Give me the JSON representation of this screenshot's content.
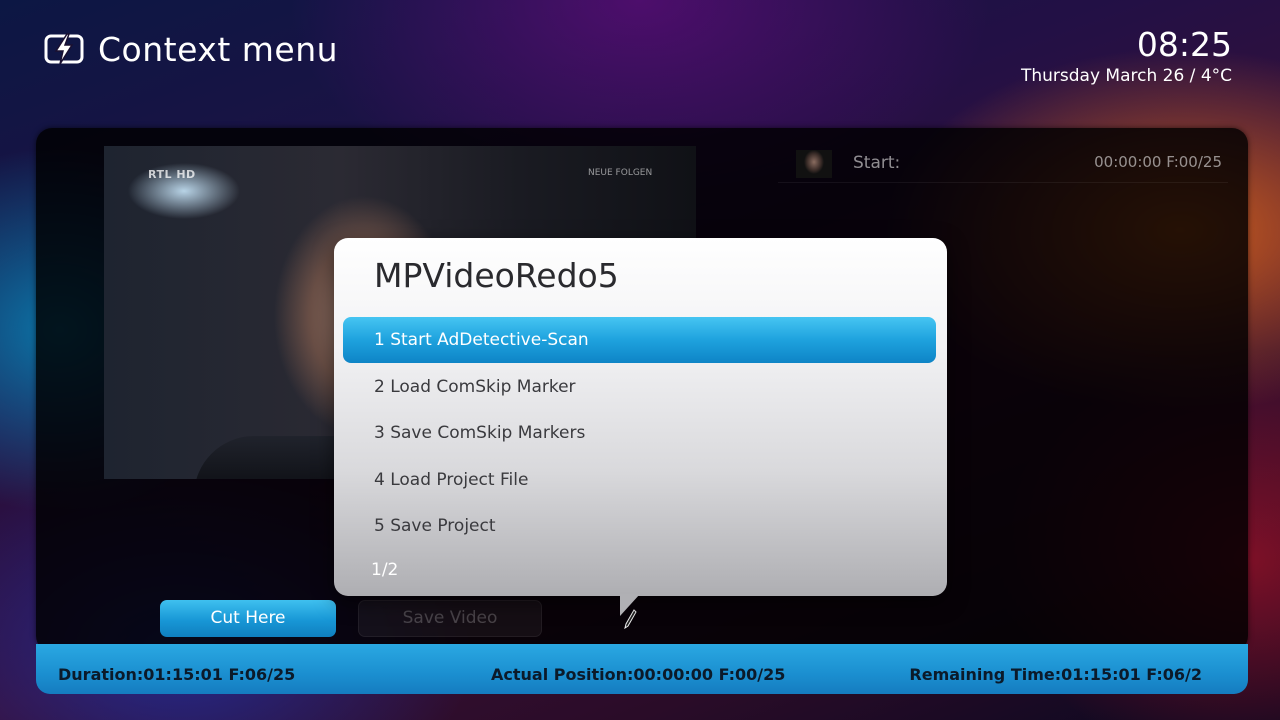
{
  "header": {
    "title": "Context menu",
    "time": "08:25",
    "date_weather": "Thursday March 26 / 4°C"
  },
  "preview": {
    "channel_logo": "RTL HD",
    "caption": "NEUE FOLGEN"
  },
  "info": {
    "start_label": "Start:",
    "start_value": "00:00:00 F:00/25"
  },
  "buttons": {
    "cut_here": "Cut Here",
    "save_video": "Save Video"
  },
  "status": {
    "duration": "Duration:01:15:01 F:06/25",
    "actual_position": "Actual Position:00:00:00 F:00/25",
    "remaining_time": "Remaining Time:01:15:01 F:06/2"
  },
  "dialog": {
    "title": "MPVideoRedo5",
    "items": [
      {
        "label": "1 Start AdDetective-Scan",
        "selected": true
      },
      {
        "label": "2 Load ComSkip Marker",
        "selected": false
      },
      {
        "label": "3 Save ComSkip Markers",
        "selected": false
      },
      {
        "label": "4 Load Project File",
        "selected": false
      },
      {
        "label": "5 Save Project",
        "selected": false
      }
    ],
    "page": "1/2"
  },
  "colors": {
    "accent": "#1e9fdc",
    "status_bar": "#1b8fd0"
  },
  "icons": {
    "logo": "mediaportal-logo-icon",
    "cursor": "mouse-cursor-icon"
  }
}
